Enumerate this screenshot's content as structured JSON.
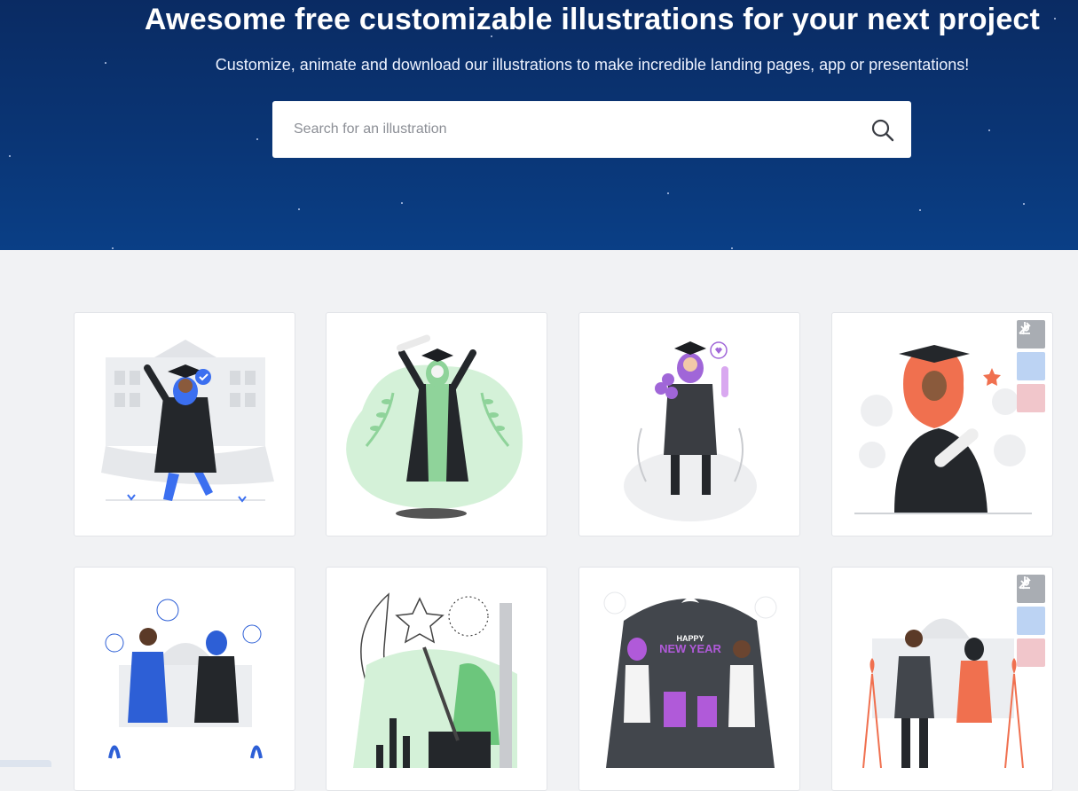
{
  "hero": {
    "title": "Awesome free customizable illustrations for your next project",
    "subtitle": "Customize, animate and download our illustrations to make incredible landing pages, app or presentations!",
    "search": {
      "placeholder": "Search for an illustration",
      "icon": "search-icon"
    }
  },
  "colors": {
    "hero_top": "#0a2b63",
    "hero_bottom": "#0a3f86",
    "page_bg": "#f1f2f4",
    "edit_button": "#a9adb3",
    "download_button": "#bcd3f3",
    "pinterest_button": "#f1c6cb"
  },
  "gallery": {
    "card_actions": [
      "edit-icon",
      "download-icon",
      "pinterest-icon"
    ],
    "cards": [
      {
        "subject": "graduation-blue",
        "accent": "#3b6ff0",
        "actions_visible": false
      },
      {
        "subject": "graduation-green",
        "accent": "#8fd39a",
        "actions_visible": false
      },
      {
        "subject": "graduation-purple",
        "accent": "#a066d8",
        "actions_visible": false
      },
      {
        "subject": "graduation-red",
        "accent": "#f0704f",
        "actions_visible": true
      },
      {
        "subject": "celebration-blue",
        "accent": "#2d5fd6",
        "actions_visible": false
      },
      {
        "subject": "ramadan-green",
        "accent": "#6cc67c",
        "actions_visible": false
      },
      {
        "subject": "new-year-purple",
        "accent": "#b05ad9",
        "actions_visible": false
      },
      {
        "subject": "celebration-red",
        "accent": "#f0704f",
        "actions_visible": true
      }
    ],
    "new_year_banner": {
      "line1": "HAPPY",
      "line2": "NEW YEAR"
    }
  }
}
